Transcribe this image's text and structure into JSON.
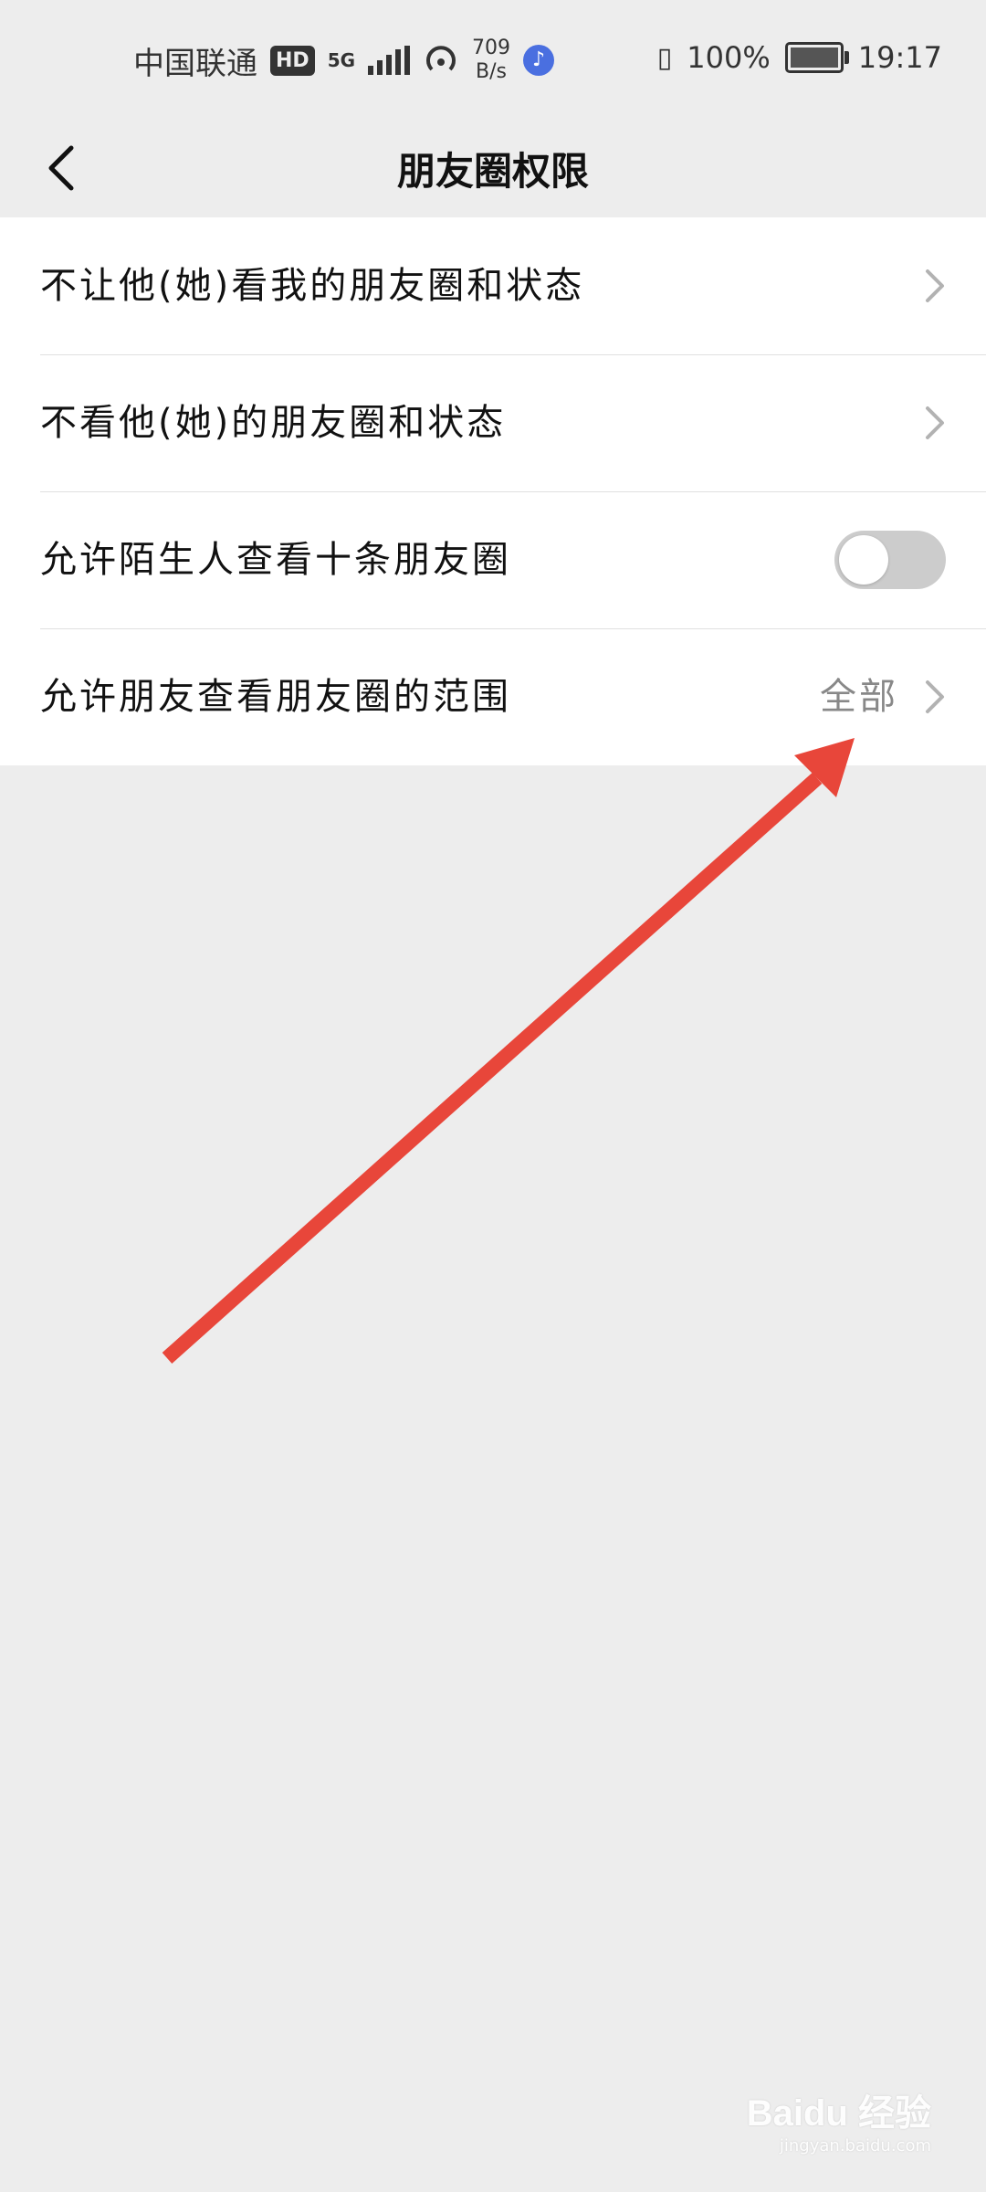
{
  "status_bar": {
    "carrier": "中国联通",
    "hd_badge": "HD",
    "network_type": "5G",
    "speed_value": "709",
    "speed_unit": "B/s",
    "battery_percent": "100%",
    "time": "19:17"
  },
  "nav": {
    "title": "朋友圈权限"
  },
  "settings": {
    "items": [
      {
        "label": "不让他(她)看我的朋友圈和状态"
      },
      {
        "label": "不看他(她)的朋友圈和状态"
      },
      {
        "label": "允许陌生人查看十条朋友圈",
        "toggle_on": false
      },
      {
        "label": "允许朋友查看朋友圈的范围",
        "value": "全部"
      }
    ]
  },
  "annotation": {
    "arrow_color": "#e8463a"
  },
  "watermark": {
    "logo": "Baidu 经验",
    "url": "jingyan.baidu.com"
  }
}
